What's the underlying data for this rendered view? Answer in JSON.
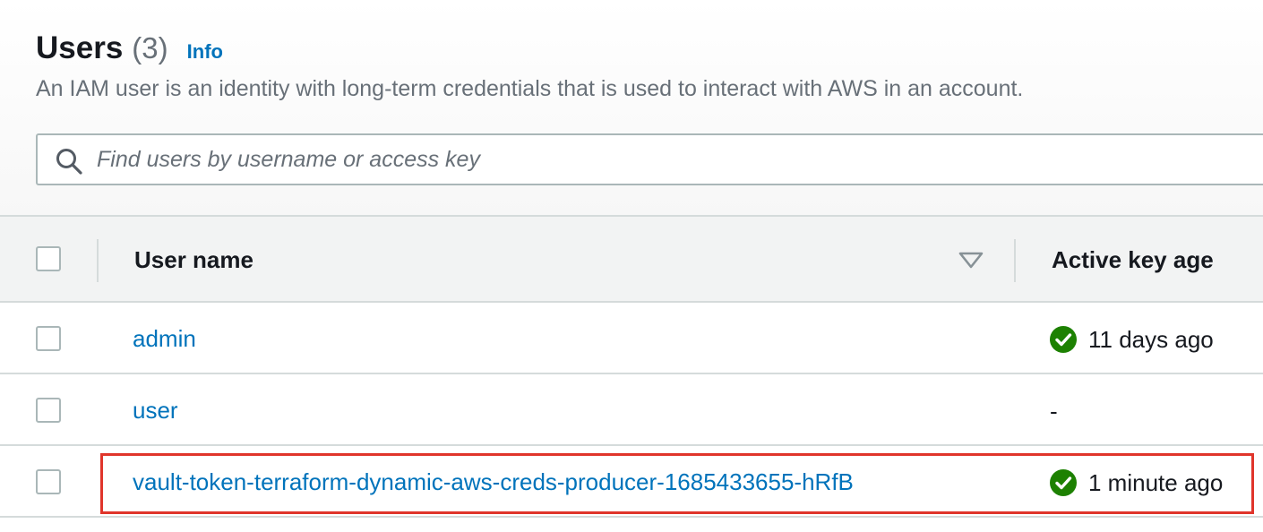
{
  "header": {
    "title": "Users",
    "count": "(3)",
    "info_label": "Info",
    "description": "An IAM user is an identity with long-term credentials that is used to interact with AWS in an account."
  },
  "search": {
    "placeholder": "Find users by username or access key",
    "value": ""
  },
  "table": {
    "columns": [
      "User name",
      "Active key age"
    ],
    "rows": [
      {
        "user_name": "admin",
        "active_key_age": "11 days ago",
        "status": "ok"
      },
      {
        "user_name": "user",
        "active_key_age": "-",
        "status": "none"
      },
      {
        "user_name": "vault-token-terraform-dynamic-aws-creds-producer-1685433655-hRfB",
        "active_key_age": "1 minute ago",
        "status": "ok",
        "highlighted": true
      }
    ]
  },
  "colors": {
    "link": "#0073bb",
    "success": "#1d8102",
    "highlight_border": "#e0352b",
    "muted_text": "#687078"
  },
  "icons": {
    "search": "search-icon",
    "sort": "sort-descending-icon",
    "status_ok": "check-circle-icon"
  }
}
